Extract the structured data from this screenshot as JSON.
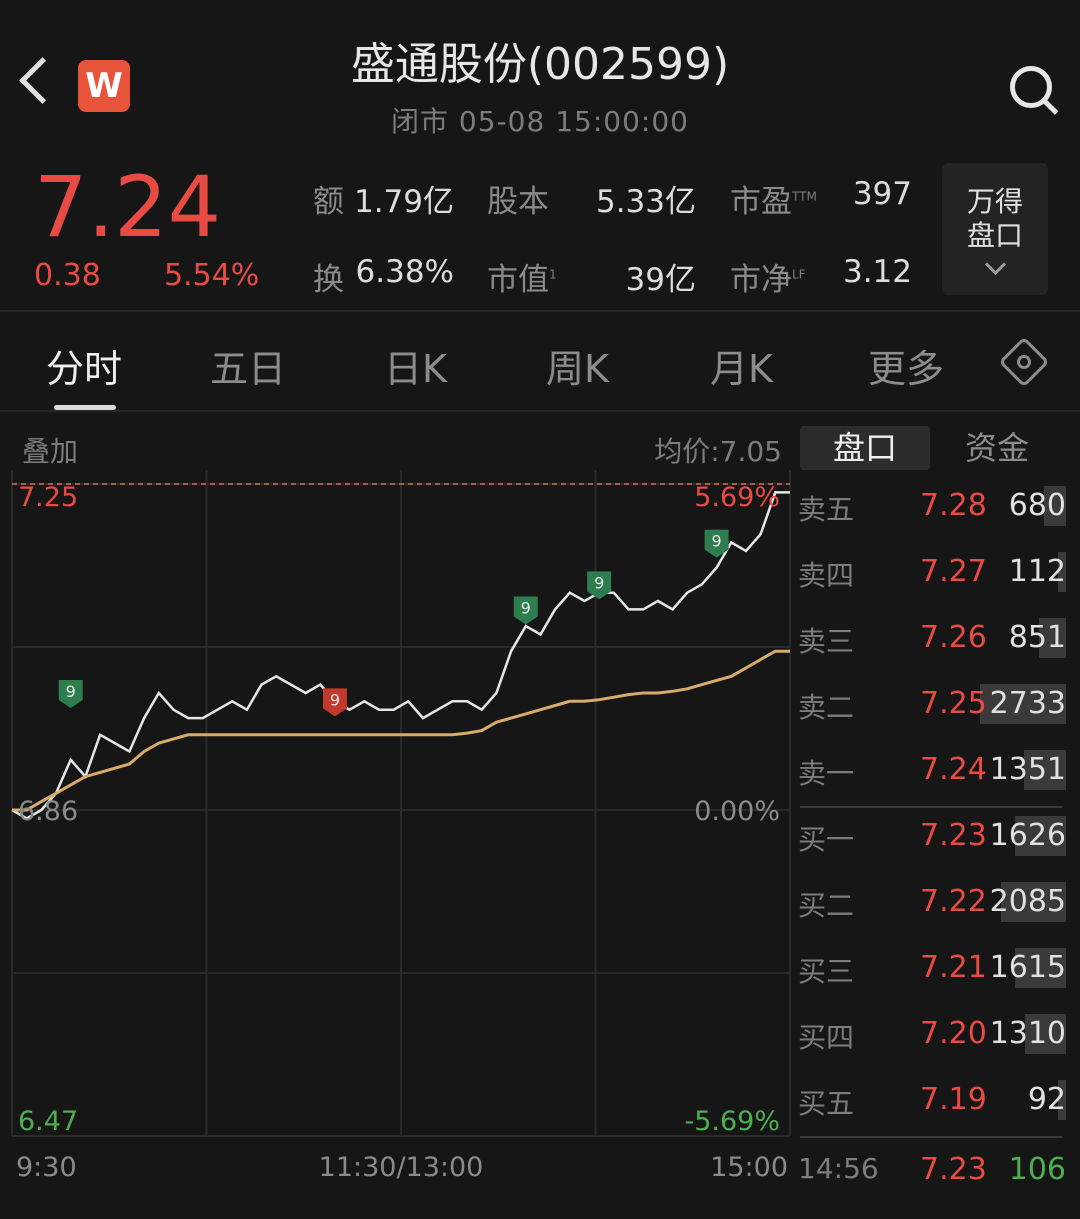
{
  "header": {
    "title": "盛通股份(002599)",
    "status": "闭市  05-08 15:00:00",
    "logo_letter": "W"
  },
  "quote": {
    "price": "7.24",
    "change": "0.38",
    "change_pct": "5.54%",
    "stats": [
      {
        "label": "额",
        "value": "1.79亿"
      },
      {
        "label": "股本",
        "value": "5.33亿"
      },
      {
        "label": "市盈",
        "sup": "TTM",
        "value": "397"
      },
      {
        "label": "换",
        "value": "6.38%"
      },
      {
        "label": "市值",
        "sup": "1",
        "value": "39亿"
      },
      {
        "label": "市净",
        "sup": "LF",
        "value": "3.12"
      }
    ],
    "wind_button": {
      "line1": "万得",
      "line2": "盘口"
    }
  },
  "tabs": [
    "分时",
    "五日",
    "日K",
    "周K",
    "月K",
    "更多"
  ],
  "chart_header": {
    "overlay": "叠加",
    "avg_price": "均价:7.05"
  },
  "chart_data": {
    "type": "line",
    "x_ticks": [
      "9:30",
      "11:30/13:00",
      "15:00"
    ],
    "y_left_ticks": [
      "7.25",
      "6.86",
      "6.47"
    ],
    "y_right_ticks": [
      "5.69%",
      "0.00%",
      "-5.69%"
    ],
    "ylim": [
      6.47,
      7.25
    ],
    "prev_close": 6.86,
    "series": [
      {
        "color": "#e6e6e6",
        "values": [
          6.86,
          6.85,
          6.86,
          6.88,
          6.92,
          6.9,
          6.95,
          6.94,
          6.93,
          6.97,
          7.0,
          6.98,
          6.97,
          6.97,
          6.98,
          6.99,
          6.98,
          7.01,
          7.02,
          7.01,
          7.0,
          7.01,
          6.99,
          6.98,
          6.99,
          6.98,
          6.98,
          6.99,
          6.97,
          6.98,
          6.99,
          6.99,
          6.98,
          7.0,
          7.05,
          7.08,
          7.07,
          7.1,
          7.12,
          7.11,
          7.12,
          7.12,
          7.1,
          7.1,
          7.11,
          7.1,
          7.12,
          7.13,
          7.15,
          7.18,
          7.17,
          7.19,
          7.24,
          7.24
        ]
      },
      {
        "color": "#d8ab6b",
        "values": [
          6.86,
          6.86,
          6.87,
          6.88,
          6.89,
          6.9,
          6.905,
          6.91,
          6.915,
          6.93,
          6.94,
          6.945,
          6.95,
          6.95,
          6.95,
          6.95,
          6.95,
          6.95,
          6.95,
          6.95,
          6.95,
          6.95,
          6.95,
          6.95,
          6.95,
          6.95,
          6.95,
          6.95,
          6.95,
          6.95,
          6.95,
          6.952,
          6.955,
          6.965,
          6.97,
          6.975,
          6.98,
          6.985,
          6.99,
          6.99,
          6.992,
          6.995,
          6.998,
          7.0,
          7.0,
          7.002,
          7.005,
          7.01,
          7.015,
          7.02,
          7.03,
          7.04,
          7.05,
          7.05
        ]
      }
    ],
    "markers": [
      {
        "label": "9",
        "color": "#2e7d4f",
        "value": 6.97,
        "index": 4
      },
      {
        "label": "9",
        "color": "#c0392b",
        "value": 6.96,
        "index": 22
      },
      {
        "label": "9",
        "color": "#2e7d4f",
        "value": 7.07,
        "index": 35
      },
      {
        "label": "9",
        "color": "#2e7d4f",
        "value": 7.1,
        "index": 40
      },
      {
        "label": "9",
        "color": "#2e7d4f",
        "value": 7.15,
        "index": 48
      }
    ]
  },
  "right_panel": {
    "tabs": [
      "盘口",
      "资金"
    ]
  },
  "order_book": {
    "asks": [
      {
        "label": "卖五",
        "price": "7.28",
        "volume": "680",
        "bar": 0.25
      },
      {
        "label": "卖四",
        "price": "7.27",
        "volume": "112",
        "bar": 0.08
      },
      {
        "label": "卖三",
        "price": "7.26",
        "volume": "851",
        "bar": 0.31
      },
      {
        "label": "卖二",
        "price": "7.25",
        "volume": "2733",
        "bar": 1.0
      },
      {
        "label": "卖一",
        "price": "7.24",
        "volume": "1351",
        "bar": 0.49
      }
    ],
    "bids": [
      {
        "label": "买一",
        "price": "7.23",
        "volume": "1626",
        "bar": 0.59
      },
      {
        "label": "买二",
        "price": "7.22",
        "volume": "2085",
        "bar": 0.76
      },
      {
        "label": "买三",
        "price": "7.21",
        "volume": "1615",
        "bar": 0.59
      },
      {
        "label": "买四",
        "price": "7.20",
        "volume": "1310",
        "bar": 0.48
      },
      {
        "label": "买五",
        "price": "7.19",
        "volume": "92",
        "bar": 0.05
      }
    ],
    "last_trade": {
      "time": "14:56",
      "price": "7.23",
      "volume": "106"
    }
  }
}
